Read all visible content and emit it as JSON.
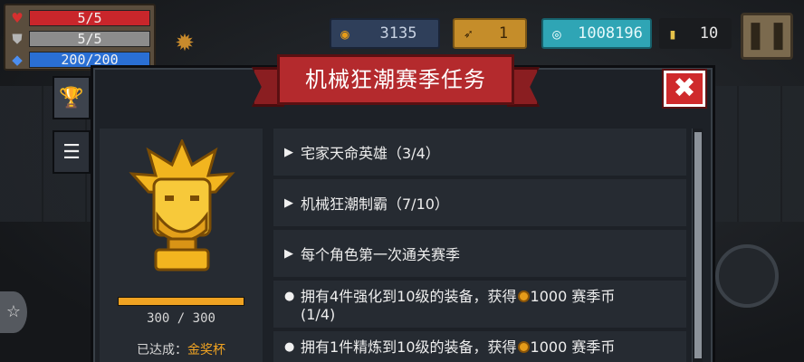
{
  "hud": {
    "hp": "5/5",
    "armor": "5/5",
    "energy": "200/200",
    "hp_icon": "heart-icon",
    "armor_icon": "shield-icon",
    "energy_icon": "diamond-icon",
    "buff_icon": "spiky-helm-icon"
  },
  "currency": {
    "coins": "3135",
    "fish": "1",
    "gems": "1008196",
    "tokens": "10",
    "coin_icon": "coin-icon",
    "fish_icon": "fish-icon",
    "gem_icon": "gem-icon",
    "token_icon": "token-icon"
  },
  "modal": {
    "title": "机械狂潮赛季任务",
    "close_label": "✖",
    "tabs": [
      {
        "icon": "trophy-icon",
        "glyph": "🏆"
      },
      {
        "icon": "list-icon",
        "glyph": "☰"
      }
    ]
  },
  "trophy": {
    "progress_text": "300 / 300",
    "progress_fraction": 1.0,
    "achieved_label": "已达成：",
    "achieved_value": "金奖杯"
  },
  "tasks": [
    {
      "mark": "▶",
      "text": "宅家天命英雄（3/4）"
    },
    {
      "mark": "▶",
      "text": "机械狂潮制霸（7/10）"
    },
    {
      "mark": "▶",
      "text": "每个角色第一次通关赛季"
    },
    {
      "mark": "●",
      "text_a": "拥有4件强化到10级的装备，获得",
      "reward": "1000 赛季币",
      "text_b": "(1/4)"
    },
    {
      "mark": "●",
      "text_a": "拥有1件精炼到10级的装备，获得",
      "reward": "1000 赛季币"
    }
  ],
  "colors": {
    "banner": "#b42a2d",
    "accent_gold": "#f0a322",
    "close": "#cf2a2c"
  }
}
